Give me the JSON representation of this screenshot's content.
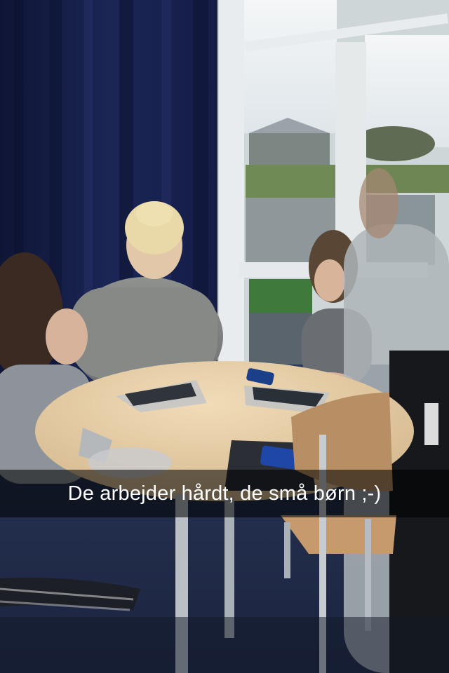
{
  "caption": {
    "text": "De arbejder hårdt, de små børn ;-)"
  },
  "colors": {
    "curtain": "#17204a",
    "window_light": "#e9edf0",
    "table": "#e6cfa9",
    "chair": "#b7946a",
    "floor": "#2a3550"
  }
}
